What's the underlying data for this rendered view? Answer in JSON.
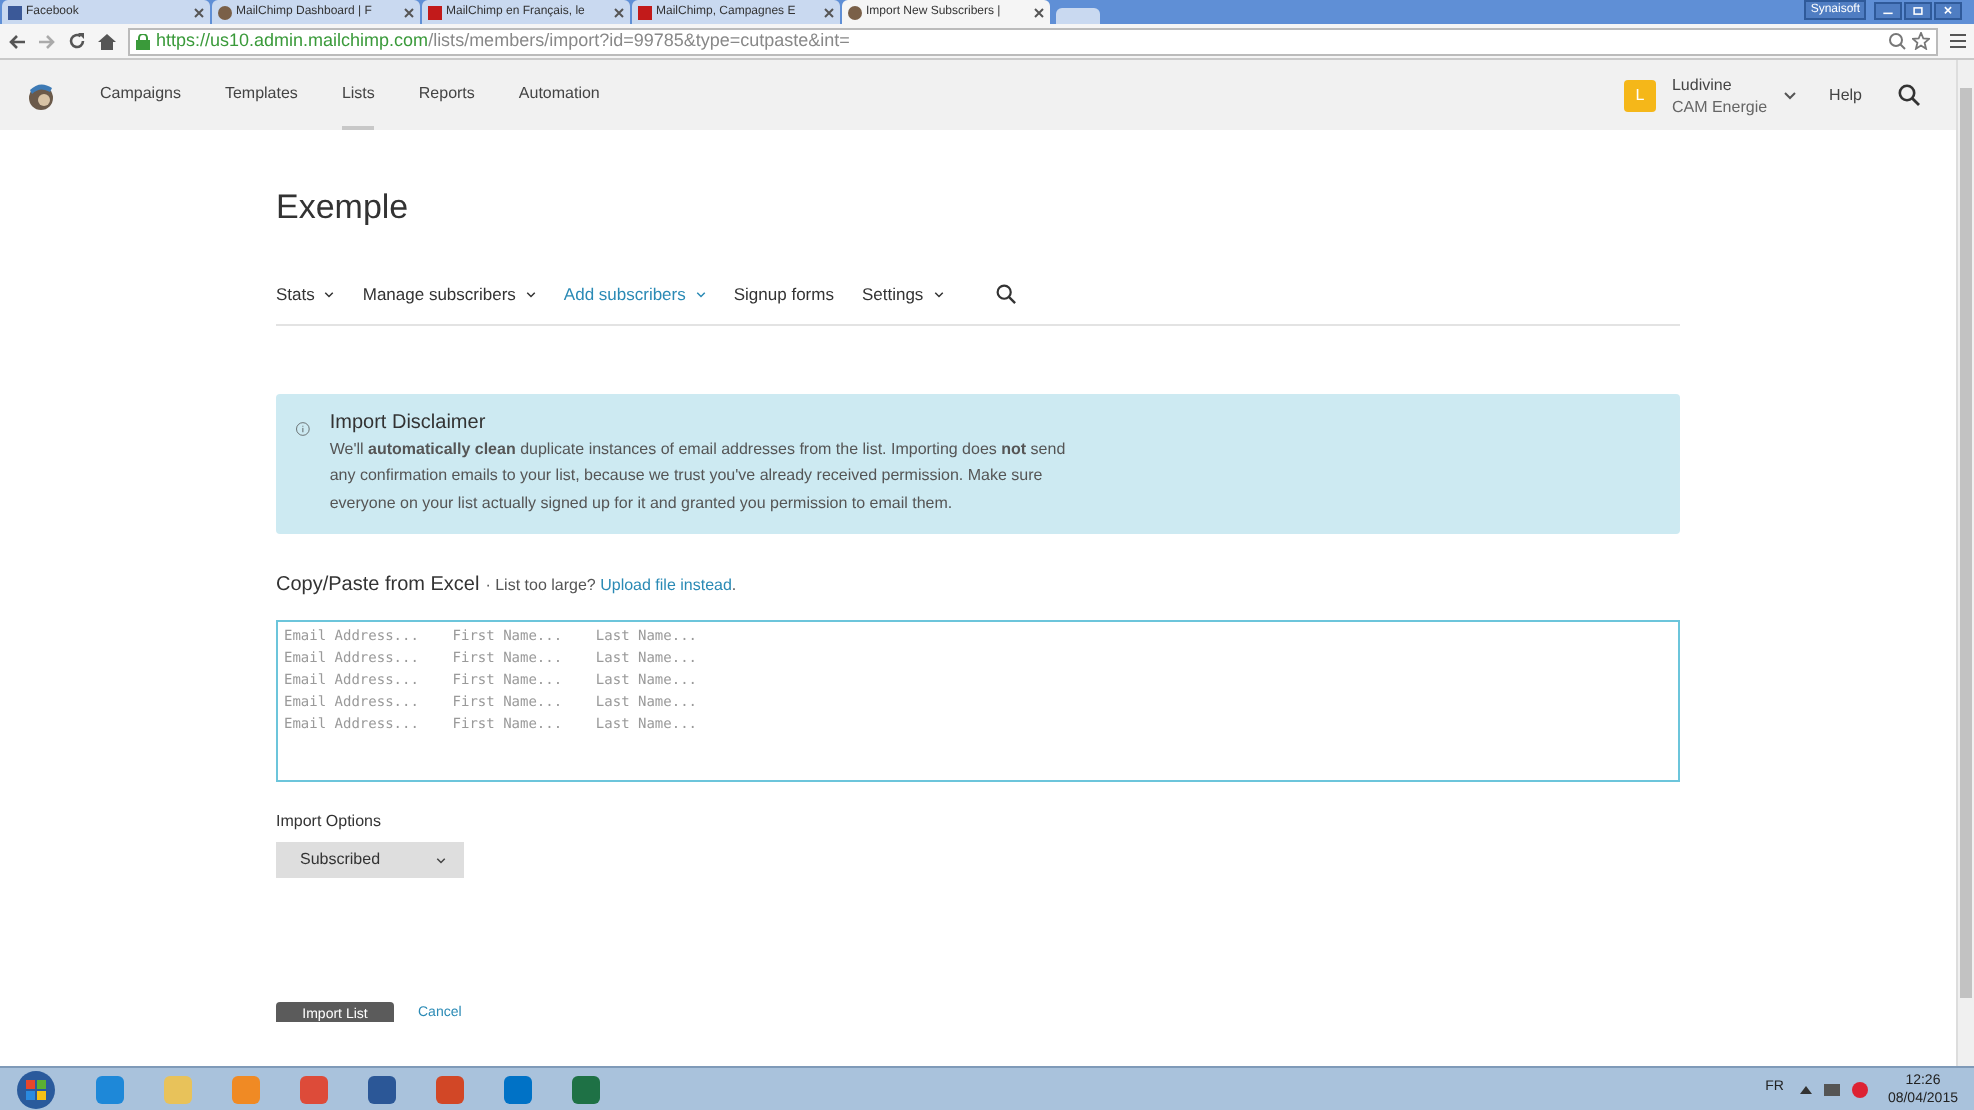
{
  "browser": {
    "tabs": [
      {
        "title": "Facebook",
        "selected": false
      },
      {
        "title": "MailChimp Dashboard | F",
        "selected": false
      },
      {
        "title": "MailChimp en Français, le",
        "selected": false
      },
      {
        "title": "MailChimp, Campagnes E",
        "selected": false
      },
      {
        "title": "Import New Subscribers |",
        "selected": true
      }
    ],
    "profile_label": "Synaisoft",
    "url_host": "https://us10.admin.mailchimp.com",
    "url_path": "/lists/members/import?id=99785&type=cutpaste&int="
  },
  "app_nav": {
    "items": [
      {
        "label": "Campaigns",
        "selected": false
      },
      {
        "label": "Templates",
        "selected": false
      },
      {
        "label": "Lists",
        "selected": true
      },
      {
        "label": "Reports",
        "selected": false
      },
      {
        "label": "Automation",
        "selected": false
      }
    ],
    "account": {
      "initial": "L",
      "name": "Ludivine",
      "company": "CAM Energie"
    },
    "help": "Help"
  },
  "list_title": "Exemple",
  "sub_nav": [
    {
      "label": "Stats",
      "dropdown": true,
      "selected": false
    },
    {
      "label": "Manage subscribers",
      "dropdown": true,
      "selected": false
    },
    {
      "label": "Add subscribers",
      "dropdown": true,
      "selected": true
    },
    {
      "label": "Signup forms",
      "dropdown": false,
      "selected": false
    },
    {
      "label": "Settings",
      "dropdown": true,
      "selected": false
    }
  ],
  "disclaimer": {
    "title": "Import Disclaimer",
    "body": "We'll **automatically clean** duplicate instances of email addresses from the list. Importing does **not** send any confirmation emails to your list, because we trust you've already received permission. Make sure everyone on your list actually signed up for it and granted you permission to email them."
  },
  "paste": {
    "title": "Copy/Paste from Excel",
    "note": "· List too large?",
    "link": "Upload file instead",
    "end": ".",
    "placeholder": "Email Address...    First Name...    Last Name...\nEmail Address...    First Name...    Last Name...\nEmail Address...    First Name...    Last Name...\nEmail Address...    First Name...    Last Name...\nEmail Address...    First Name...    Last Name..."
  },
  "import_options": {
    "label": "Import Options",
    "value": "Subscribed"
  },
  "buttons": {
    "import": "Import List",
    "cancel": "Cancel"
  },
  "taskbar": {
    "language": "FR",
    "time": "12:26",
    "date": "08/04/2015"
  }
}
